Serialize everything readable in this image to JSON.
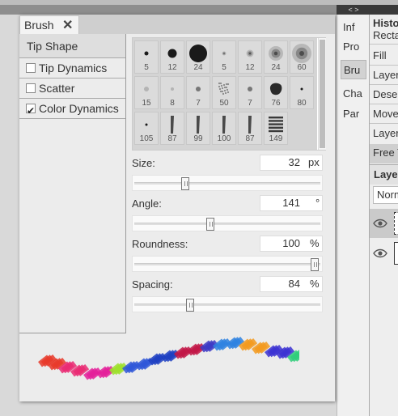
{
  "palettes": {
    "arrows": "< >",
    "items": [
      "Inf",
      "Pro",
      "Bru",
      "Cha",
      "Par"
    ],
    "active_index": 2
  },
  "history": {
    "title": "History",
    "items": [
      "Rectangle Select",
      "Fill",
      "Layer Properties",
      "Deselect",
      "Move",
      "Layer Properties",
      "Free Transform"
    ],
    "selected_index": 6
  },
  "layers": {
    "title": "Layers",
    "blend_mode": "Normal"
  },
  "dialog": {
    "title": "Brush",
    "close_symbol": "✕",
    "sidebar": [
      {
        "label": "Tip Shape",
        "type": "header"
      },
      {
        "label": "Tip Dynamics",
        "checked": false
      },
      {
        "label": "Scatter",
        "checked": false
      },
      {
        "label": "Color Dynamics",
        "checked": true
      }
    ],
    "brushes": [
      {
        "size": "5",
        "style": "dot",
        "d": 5
      },
      {
        "size": "12",
        "style": "dot",
        "d": 11
      },
      {
        "size": "24",
        "style": "dot",
        "d": 22
      },
      {
        "size": "5",
        "style": "soft",
        "d": 5
      },
      {
        "size": "12",
        "style": "soft",
        "d": 9
      },
      {
        "size": "24",
        "style": "soft",
        "d": 18
      },
      {
        "size": "60",
        "style": "soft",
        "d": 24
      },
      {
        "size": "15",
        "style": "speck",
        "d": 6
      },
      {
        "size": "8",
        "style": "speck",
        "d": 4
      },
      {
        "size": "7",
        "style": "ring",
        "d": 6
      },
      {
        "size": "50",
        "style": "grain",
        "d": 16
      },
      {
        "size": "7",
        "style": "ring",
        "d": 6
      },
      {
        "size": "76",
        "style": "blob",
        "d": 16
      },
      {
        "size": "80",
        "style": "dot",
        "d": 3
      },
      {
        "size": "105",
        "style": "dot",
        "d": 3
      },
      {
        "size": "87",
        "style": "stroke",
        "d": 22
      },
      {
        "size": "99",
        "style": "stroke",
        "d": 24
      },
      {
        "size": "100",
        "style": "stroke",
        "d": 24
      },
      {
        "size": "87",
        "style": "stroke",
        "d": 22
      },
      {
        "size": "149",
        "style": "hatch",
        "d": 22
      }
    ],
    "controls": [
      {
        "label": "Size:",
        "value": "32",
        "unit": "px",
        "fraction": 0.26
      },
      {
        "label": "Angle:",
        "value": "141",
        "unit": "°",
        "fraction": 0.4
      },
      {
        "label": "Roundness:",
        "value": "100",
        "unit": "%",
        "fraction": 0.98
      },
      {
        "label": "Spacing:",
        "value": "84",
        "unit": "%",
        "fraction": 0.29
      }
    ],
    "preview_colors": [
      "#e8392a",
      "#ea2a73",
      "#e4209a",
      "#9ee02a",
      "#2f57d8",
      "#1d3fc2",
      "#c21646",
      "#3c3ac6",
      "#2f83e0",
      "#f39a1e",
      "#3c32d2",
      "#2fce7a"
    ]
  }
}
